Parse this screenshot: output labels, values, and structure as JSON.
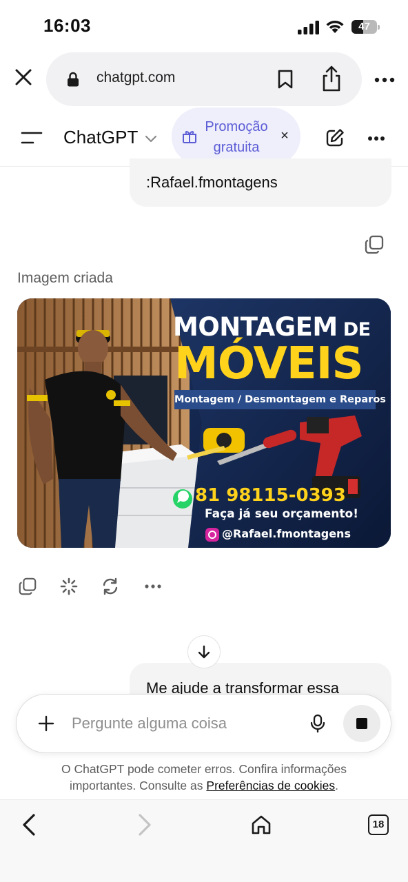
{
  "status_bar": {
    "time": "16:03",
    "battery_level": "47",
    "icons": [
      "cellular-signal-icon",
      "wifi-icon",
      "battery-icon"
    ]
  },
  "browser": {
    "url": "chatgpt.com",
    "icons": [
      "close-icon",
      "lock-icon",
      "bookmark-icon",
      "share-icon",
      "more-horizontal-icon"
    ]
  },
  "app_header": {
    "title": "ChatGPT",
    "promo_label": "Promoção gratuita",
    "promo_close": "×",
    "icons": [
      "menu-icon",
      "chevron-down-icon",
      "gift-icon",
      "new-chat-icon",
      "more-horizontal-icon"
    ]
  },
  "conversation": {
    "user_message_1": ":Rafael.fmontagens",
    "image_label": "Imagem criada",
    "generated_image": {
      "headline_1": "MONTAGEM",
      "headline_1b": "DE",
      "headline_2": "MÓVEIS",
      "subtitle": "Montagem / Desmontagem e Reparos",
      "phone": "81 98115-0393",
      "cta": "Faça já seu orçamento!",
      "instagram": "@Rafael.fmontagens"
    },
    "action_icons": [
      "copy-icon",
      "loading-spinner-icon",
      "regenerate-icon",
      "more-horizontal-icon"
    ],
    "user_message_2": "Me ajude a transformar essa"
  },
  "composer": {
    "placeholder": "Pergunte alguma coisa",
    "icons": [
      "plus-icon",
      "microphone-icon",
      "stop-icon"
    ]
  },
  "disclaimer": {
    "text": "O ChatGPT pode cometer erros. Confira informações importantes. Consulte as",
    "link": "Preferências de cookies",
    "end": "."
  },
  "toolbar": {
    "tab_count": "18",
    "icons": [
      "back-icon",
      "forward-icon",
      "home-icon",
      "tabs-icon"
    ]
  },
  "colors": {
    "promo_bg": "#eeeffb",
    "promo_text": "#5c5cd6",
    "bubble_bg": "#f4f4f4",
    "poster_yellow": "#ffd21c",
    "poster_navy": "#0f1f3f"
  }
}
